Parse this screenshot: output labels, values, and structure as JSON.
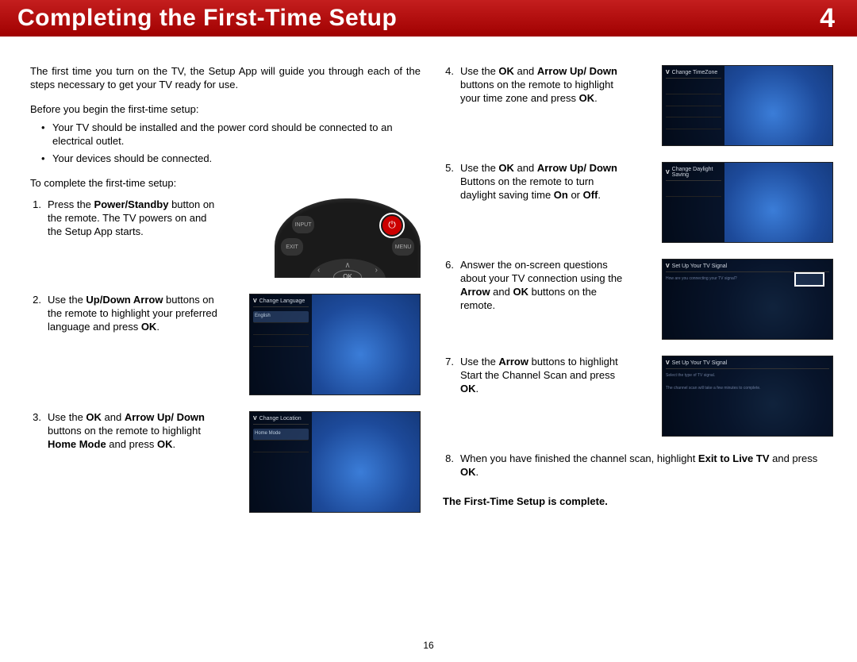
{
  "header": {
    "title": "Completing the First-Time Setup",
    "chapter": "4"
  },
  "intro": "The first time you turn on the TV, the Setup App will guide you through each of the steps necessary to get your TV ready for use.",
  "before_lead": "Before you begin the first-time setup:",
  "before_bullets": [
    "Your TV should be installed and the power cord should be connected to an electrical outlet.",
    "Your devices should be connected."
  ],
  "complete_lead": "To complete the first-time setup:",
  "steps": {
    "s1_num": "1.",
    "s1": "Press the <b>Power/Standby</b> button on the remote. The TV powers on and the Setup App starts.",
    "s2_num": "2.",
    "s2": "Use the <b>Up/Down Arrow</b> buttons on the remote to highlight your preferred language and press <b>OK</b>.",
    "s3_num": "3.",
    "s3": "Use the <b>OK</b> and <b>Arrow Up/ Down</b> buttons on the remote to highlight <b>Home Mode</b> and press <b>OK</b>.",
    "s4_num": "4.",
    "s4": "Use the <b>OK</b> and <b>Arrow Up/ Down</b> buttons on the remote to highlight your time zone and press <b>OK</b>.",
    "s5_num": "5.",
    "s5": "Use the <b>OK</b> and <b>Arrow Up/ Down</b> Buttons on the remote to turn daylight saving time <b>On</b> or <b>Off</b>.",
    "s6_num": "6.",
    "s6": "Answer the on-screen questions about your TV connection using the <b>Arrow</b> and <b>OK</b> buttons on the remote.",
    "s7_num": "7.",
    "s7": "Use the <b>Arrow</b> buttons to highlight Start the Channel Scan and press <b>OK</b>.",
    "s8_num": "8.",
    "s8": "When you have finished the channel scan, highlight <b>Exit to Live TV</b> and press <b>OK</b>."
  },
  "panels": {
    "p2_title": "Change Language",
    "p3_title": "Change Location",
    "p4_title": "Change TimeZone",
    "p5_title": "Change Daylight Saving",
    "p6_title": "Set Up Your TV Signal",
    "p7_title": "Set Up Your TV Signal"
  },
  "remote_labels": {
    "input": "INPUT",
    "exit": "EXIT",
    "menu": "MENU",
    "ok": "OK"
  },
  "closing": "The First-Time Setup is complete.",
  "page_number": "16"
}
